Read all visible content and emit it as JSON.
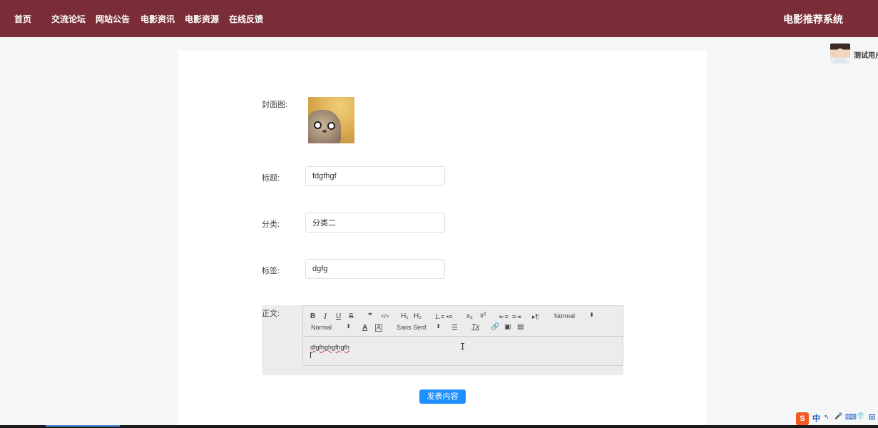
{
  "nav": {
    "items": [
      "首页",
      "交流论坛",
      "网站公告",
      "电影资讯",
      "电影资源",
      "在线反馈"
    ],
    "site_title": "电影推荐系统"
  },
  "user": {
    "name": "测试用户"
  },
  "form": {
    "cover_label": "封面图:",
    "title_label": "标题:",
    "title_value": "fdgfhgf",
    "category_label": "分类:",
    "category_value": "分类二",
    "tags_label": "标签:",
    "tags_value": "dgfg",
    "body_label": "正文:",
    "submit_label": "发表内容"
  },
  "editor": {
    "toolbar": {
      "bold": "B",
      "italic": "I",
      "underline": "U",
      "strike": "S",
      "blockquote": "❞",
      "code": "</>",
      "h1": "H₁",
      "h2": "H₂",
      "ordered_list": "⒈≡",
      "bullet_list": "•≡",
      "subscript": "x₂",
      "superscript": "x²",
      "outdent": "⇤≡",
      "indent": "≡⇥",
      "direction": "▸¶",
      "header_select": "Normal",
      "size_select": "Normal",
      "color": "A",
      "background": "A",
      "font_select": "Sans Serif",
      "align": "☰",
      "clean": "Tx",
      "link": "🔗",
      "image": "▣",
      "video": "▤"
    },
    "content": "dfgfhghgfhgfh"
  },
  "tray": {
    "ime": "S",
    "lang": "中",
    "punct": "•,",
    "mic": "🎤",
    "keyboard": "⌨",
    "shirt": "👕",
    "grid": "⊞"
  },
  "colors": {
    "topbar": "#7a2d37",
    "submit": "#1e8fff",
    "background": "#f5f6f7"
  }
}
